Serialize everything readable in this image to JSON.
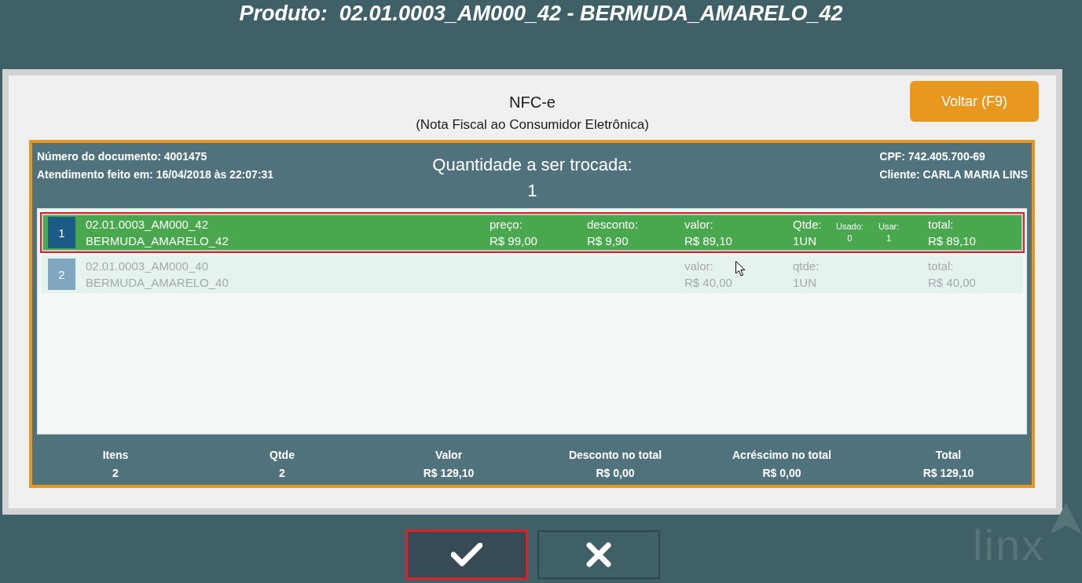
{
  "header": {
    "title": "Produto:  02.01.0003_AM000_42 - BERMUDA_AMARELO_42"
  },
  "dialog": {
    "title": "NFC-e",
    "subtitle": "(Nota Fiscal ao Consumidor Eletrônica)",
    "back_button": "Voltar (F9)"
  },
  "document": {
    "number": "Número do documento: 4001475",
    "service_time": "Atendimento feito em: 16/04/2018 às 22:07:31",
    "exchange_label": "Quantidade a ser trocada:",
    "exchange_quantity": "1",
    "cpf": "CPF: 742.405.700-69",
    "customer": "Cliente: CARLA MARIA LINS"
  },
  "items": [
    {
      "index": "1",
      "code": "02.01.0003_AM000_42",
      "name": "BERMUDA_AMARELO_42",
      "selected": true,
      "disabled": false,
      "price": {
        "label": "preço:",
        "value": "R$ 99,00"
      },
      "discount": {
        "label": "desconto:",
        "value": "R$ 9,90"
      },
      "amount": {
        "label": "valor:",
        "value": "R$ 89,10"
      },
      "quantity": {
        "label": "Qtde:",
        "value": "1UN"
      },
      "used": {
        "label": "Usado:",
        "value": "0"
      },
      "to_use": {
        "label": "Usar:",
        "value": "1"
      },
      "total": {
        "label": "total:",
        "value": "R$ 89,10"
      }
    },
    {
      "index": "2",
      "code": "02.01.0003_AM000_40",
      "name": "BERMUDA_AMARELO_40",
      "selected": false,
      "disabled": true,
      "amount": {
        "label": "valor:",
        "value": "R$ 40,00"
      },
      "quantity": {
        "label": "qtde:",
        "value": "1UN"
      },
      "total": {
        "label": "total:",
        "value": "R$ 40,00"
      }
    }
  ],
  "totals": [
    {
      "label": "Itens",
      "value": "2"
    },
    {
      "label": "Qtde",
      "value": "2"
    },
    {
      "label": "Valor",
      "value": "R$ 129,10"
    },
    {
      "label": "Desconto no total",
      "value": "R$ 0,00"
    },
    {
      "label": "Acréscimo no total",
      "value": "R$ 0,00"
    },
    {
      "label": "Total",
      "value": "R$ 129,10"
    }
  ],
  "actions": [
    {
      "kind": "confirm",
      "selected": true
    },
    {
      "kind": "cancel",
      "selected": false
    }
  ],
  "logo": {
    "text": "linx"
  }
}
